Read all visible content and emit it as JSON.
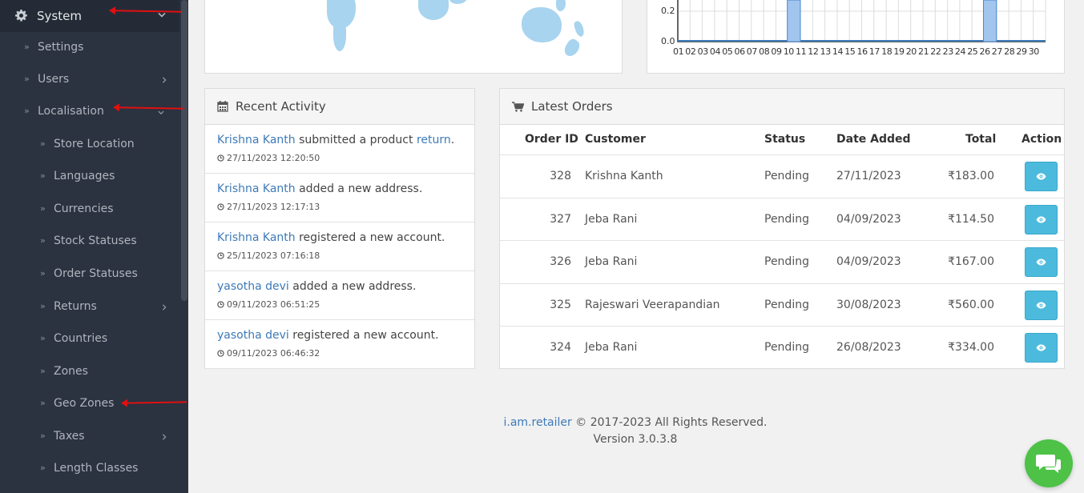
{
  "sidebar": {
    "system": {
      "label": "System",
      "icon": "gear-icon"
    },
    "items": [
      {
        "label": "Settings",
        "icon": "double-chevron-right-icon"
      },
      {
        "label": "Users",
        "icon": "double-chevron-right-icon"
      },
      {
        "label": "Localisation",
        "icon": "double-chevron-right-icon"
      },
      {
        "label": "Store Location",
        "icon": "double-chevron-right-icon"
      },
      {
        "label": "Languages",
        "icon": "double-chevron-right-icon"
      },
      {
        "label": "Currencies",
        "icon": "double-chevron-right-icon"
      },
      {
        "label": "Stock Statuses",
        "icon": "double-chevron-right-icon"
      },
      {
        "label": "Order Statuses",
        "icon": "double-chevron-right-icon"
      },
      {
        "label": "Returns",
        "icon": "double-chevron-right-icon"
      },
      {
        "label": "Countries",
        "icon": "double-chevron-right-icon"
      },
      {
        "label": "Zones",
        "icon": "double-chevron-right-icon"
      },
      {
        "label": "Geo Zones",
        "icon": "double-chevron-right-icon"
      },
      {
        "label": "Taxes",
        "icon": "double-chevron-right-icon"
      },
      {
        "label": "Length Classes",
        "icon": "double-chevron-right-icon"
      }
    ]
  },
  "chart": {
    "ylabels": [
      "0.2",
      "0.0"
    ],
    "xticks": [
      "01",
      "02",
      "03",
      "04",
      "05",
      "06",
      "07",
      "08",
      "09",
      "10",
      "11",
      "12",
      "13",
      "14",
      "15",
      "16",
      "17",
      "18",
      "19",
      "20",
      "21",
      "22",
      "23",
      "24",
      "25",
      "26",
      "27",
      "28",
      "29",
      "30"
    ]
  },
  "recent_activity": {
    "title": "Recent Activity",
    "icon": "calendar-icon",
    "items": [
      {
        "name": "Krishna Kanth",
        "text": " submitted a product ",
        "link": "return",
        "tail": ".",
        "time": "27/11/2023 12:20:50"
      },
      {
        "name": "Krishna Kanth",
        "text": " added a new address.",
        "link": "",
        "tail": "",
        "time": "27/11/2023 12:17:13"
      },
      {
        "name": "Krishna Kanth",
        "text": " registered a new account.",
        "link": "",
        "tail": "",
        "time": "25/11/2023 07:16:18"
      },
      {
        "name": "yasotha devi",
        "text": " added a new address.",
        "link": "",
        "tail": "",
        "time": "09/11/2023 06:51:25"
      },
      {
        "name": "yasotha devi",
        "text": " registered a new account.",
        "link": "",
        "tail": "",
        "time": "09/11/2023 06:46:32"
      }
    ]
  },
  "latest_orders": {
    "title": "Latest Orders",
    "icon": "shopping-cart-icon",
    "columns": [
      "Order ID",
      "Customer",
      "Status",
      "Date Added",
      "Total",
      "Action"
    ],
    "rows": [
      {
        "id": "328",
        "customer": "Krishna Kanth",
        "status": "Pending",
        "date": "27/11/2023",
        "total": "₹183.00"
      },
      {
        "id": "327",
        "customer": "Jeba Rani",
        "status": "Pending",
        "date": "04/09/2023",
        "total": "₹114.50"
      },
      {
        "id": "326",
        "customer": "Jeba Rani",
        "status": "Pending",
        "date": "04/09/2023",
        "total": "₹167.00"
      },
      {
        "id": "325",
        "customer": "Rajeswari Veerapandian",
        "status": "Pending",
        "date": "30/08/2023",
        "total": "₹560.00"
      },
      {
        "id": "324",
        "customer": "Jeba Rani",
        "status": "Pending",
        "date": "26/08/2023",
        "total": "₹334.00"
      }
    ]
  },
  "footer": {
    "brand": "i.am.retailer",
    "copyright": " © 2017-2023 All Rights Reserved.",
    "version": "Version 3.0.3.8"
  },
  "colors": {
    "sidebar_bg": "#2b3240",
    "link": "#3d7ab8",
    "view_button": "#4bbadc",
    "chat_button": "#4dc247",
    "annotation_arrow": "#e01010"
  }
}
